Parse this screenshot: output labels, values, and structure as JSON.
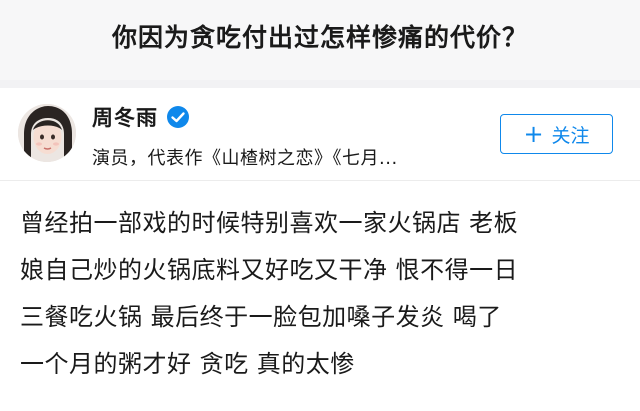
{
  "question": {
    "title": "你因为贪吃付出过怎样惨痛的代价？"
  },
  "author": {
    "name": "周冬雨",
    "verified_icon": "verified-badge-icon",
    "bio": "演员，代表作《山楂树之恋》《七月...",
    "avatar": "avatar-photo"
  },
  "follow_button": {
    "icon": "plus-icon",
    "plus_glyph": "+",
    "label": "关注"
  },
  "answer": {
    "lines": [
      "曾经拍一部戏的时候特别喜欢一家火锅店 老板",
      "娘自己炒的火锅底料又好吃又干净 恨不得一日",
      "三餐吃火锅 最后终于一脸包加嗓子发炎 喝了",
      "一个月的粥才好 贪吃 真的太惨"
    ]
  },
  "colors": {
    "accent": "#0f88eb",
    "background": "#f2f2f4",
    "card": "#ffffff",
    "text": "#1a1a1a"
  }
}
